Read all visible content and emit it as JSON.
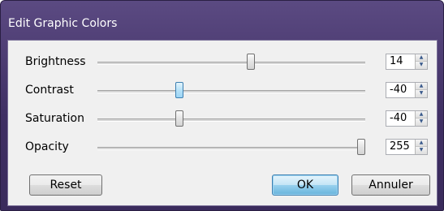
{
  "window": {
    "title": "Edit Graphic Colors"
  },
  "rows": [
    {
      "label": "Brightness",
      "value": "14",
      "thumb_fraction": 0.575
    },
    {
      "label": "Contrast",
      "value": "-40",
      "thumb_fraction": 0.3
    },
    {
      "label": "Saturation",
      "value": "-40",
      "thumb_fraction": 0.3
    },
    {
      "label": "Opacity",
      "value": "255",
      "thumb_fraction": 1.0
    }
  ],
  "buttons": {
    "reset": "Reset",
    "ok": "OK",
    "cancel": "Annuler"
  }
}
